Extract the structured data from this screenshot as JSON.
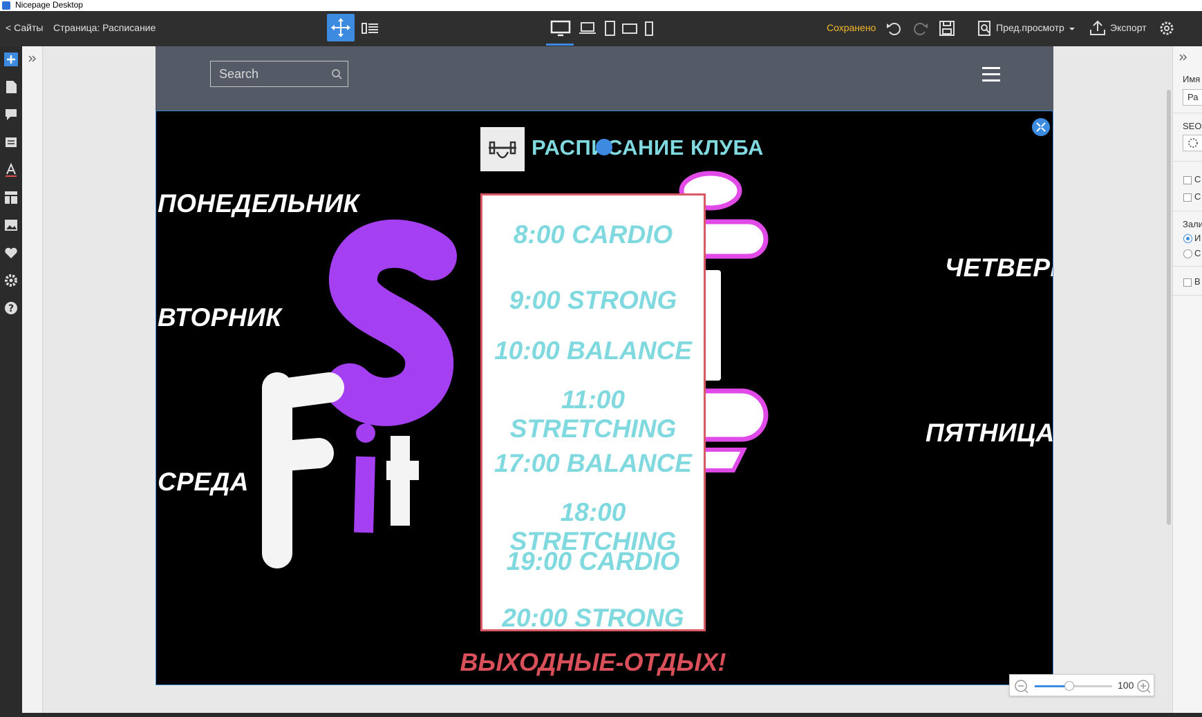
{
  "window": {
    "title": "Nicepage Desktop"
  },
  "toolbar": {
    "back_label": "< Сайты",
    "page_label": "Страница: Расписание",
    "saved_label": "Сохранено",
    "preview_label": "Пред.просмотр",
    "export_label": "Экспорт",
    "active_device": "desktop",
    "accent_color": "#3d8be0"
  },
  "site": {
    "search_placeholder": "Search",
    "title": "РАСПИСАНИЕ КЛУБА",
    "days": {
      "monday": "ПОНЕДЕЛЬНИК",
      "tuesday": "ВТОРНИК",
      "wednesday": "СРЕДА",
      "thursday": "ЧЕТВЕРГ",
      "friday": "ПЯТНИЦА"
    },
    "schedule": [
      "8:00 CARDIO",
      "9:00 STRONG",
      "10:00 BALANCE",
      "11:00 STRETCHING",
      "17:00 BALANCE",
      "18:00 STRETCHING",
      "19:00 CARDIO",
      "20:00 STRONG"
    ],
    "weekend": "ВЫХОДНЫЕ-ОТДЫХ!",
    "title_color": "#7fd9df",
    "weekend_color": "#d9505a",
    "sign_colors": {
      "purple": "#a43ff2",
      "white": "#ffffff"
    }
  },
  "zoom": {
    "value": "100",
    "level": 0.45
  },
  "right_panel": {
    "name_label": "Имя",
    "name_value": "Ра",
    "seo_label": "SEO",
    "fill_label": "Зали",
    "radio_1": "И",
    "radio_2": "С",
    "check_3": "В",
    "check_1": "С",
    "check_2": "С"
  }
}
